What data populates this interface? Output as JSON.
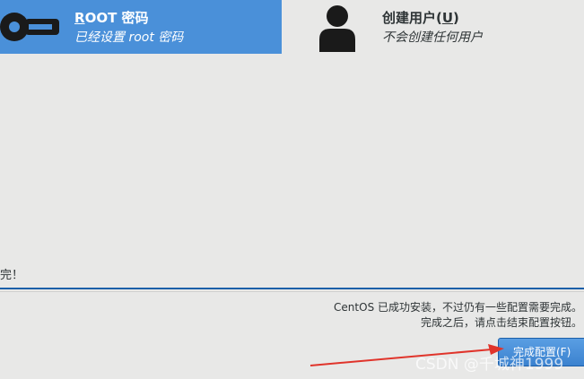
{
  "spokes": {
    "root": {
      "icon": "key-icon",
      "title_mnemonic": "R",
      "title_rest": "OOT 密码",
      "status": "已经设置 root 密码",
      "selected_color": "#4a90d9"
    },
    "user": {
      "icon": "user-icon",
      "title_main": "创建用户(",
      "title_mnemonic": "U",
      "title_end": ")",
      "status": "不会创建任何用户"
    }
  },
  "progress": {
    "text": "完！"
  },
  "bottom": {
    "message_line1": "CentOS 已成功安装，不过仍有一些配置需要完成。",
    "message_line2": "完成之后，请点击结束配置按钮。",
    "finish_button": "完成配置(F)",
    "accent_color": "#1b5fa8"
  },
  "annotation": {
    "arrow_color": "#e0342b"
  },
  "watermark": "CSDN @千城神1999"
}
